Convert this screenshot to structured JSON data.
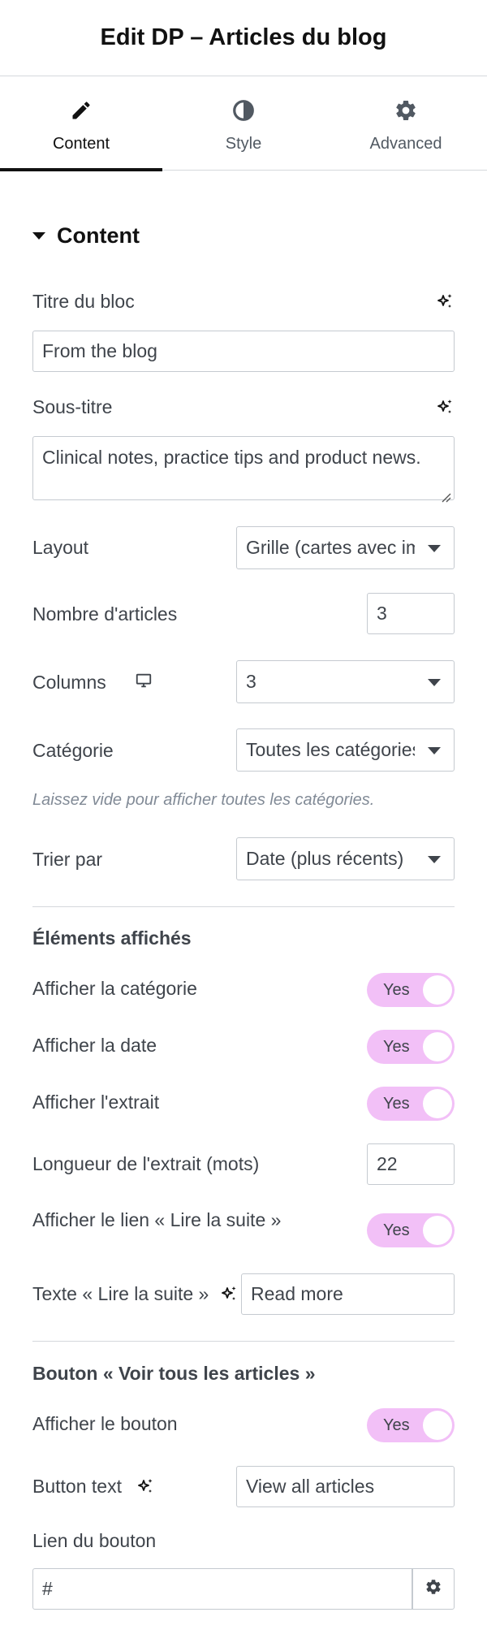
{
  "header": {
    "title": "Edit DP – Articles du blog"
  },
  "tabs": [
    {
      "label": "Content",
      "icon": "pencil-icon",
      "active": true
    },
    {
      "label": "Style",
      "icon": "half-circle-icon",
      "active": false
    },
    {
      "label": "Advanced",
      "icon": "gear-icon",
      "active": false
    }
  ],
  "section": {
    "title": "Content"
  },
  "fields": {
    "titre": {
      "label": "Titre du bloc",
      "value": "From the blog"
    },
    "soustitre": {
      "label": "Sous-titre",
      "value": "Clinical notes, practice tips and product news."
    },
    "layout": {
      "label": "Layout",
      "value": "Grille (cartes avec images)"
    },
    "nombre": {
      "label": "Nombre d'articles",
      "value": "3"
    },
    "columns": {
      "label": "Columns",
      "value": "3",
      "icon": "desktop-icon"
    },
    "categorie": {
      "label": "Catégorie",
      "value": "Toutes les catégories"
    },
    "hint": "Laissez vide pour afficher toutes les catégories.",
    "trier": {
      "label": "Trier par",
      "value": "Date (plus récents)"
    }
  },
  "elements": {
    "heading": "Éléments affichés",
    "afficher_categorie": {
      "label": "Afficher la catégorie",
      "toggle": "Yes"
    },
    "afficher_date": {
      "label": "Afficher la date",
      "toggle": "Yes"
    },
    "afficher_extrait": {
      "label": "Afficher l'extrait",
      "toggle": "Yes"
    },
    "longueur": {
      "label": "Longueur de l'extrait (mots)",
      "value": "22"
    },
    "afficher_lien": {
      "label": "Afficher le lien « Lire la suite »",
      "toggle": "Yes"
    },
    "texte_lire": {
      "label": "Texte « Lire la suite »",
      "value": "Read more"
    }
  },
  "bouton": {
    "heading": "Bouton « Voir tous les articles »",
    "afficher": {
      "label": "Afficher le bouton",
      "toggle": "Yes"
    },
    "text": {
      "label": "Button text",
      "value": "View all articles"
    },
    "lien": {
      "label": "Lien du bouton",
      "value": "#"
    }
  },
  "colors": {
    "toggle_on": "#f2c0f7",
    "text": "#3f444b",
    "border": "#c5cad0"
  }
}
